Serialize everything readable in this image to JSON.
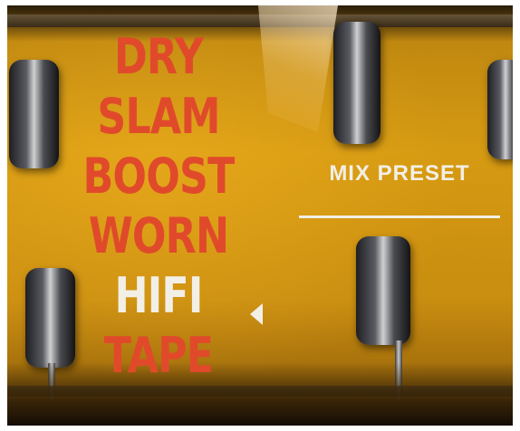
{
  "presets": {
    "items": [
      {
        "label": "DRY"
      },
      {
        "label": "SLAM"
      },
      {
        "label": "BOOST"
      },
      {
        "label": "WORN"
      },
      {
        "label": "HIFI"
      },
      {
        "label": "TAPE"
      }
    ],
    "selected_label": "HIFI"
  },
  "mix": {
    "label": "MIX PRESET"
  },
  "colors": {
    "accent": "#e04a2b",
    "selected": "#f2efe6",
    "background": "#d69a12"
  },
  "icons": {
    "selection_indicator": "triangle-left-icon"
  }
}
